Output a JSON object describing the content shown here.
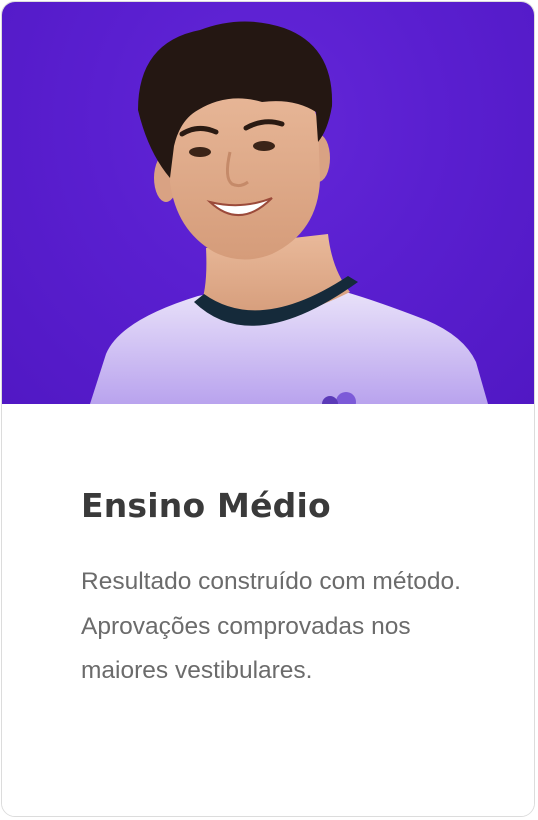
{
  "card": {
    "title": "Ensino Médio",
    "description": "Resultado construído com método. Aprovações comprovadas nos maiores vestibulares.",
    "image_alt": "Smiling student wearing a light lavender t-shirt",
    "colors": {
      "hero_background": "#5a1fd0",
      "title": "#3a3a3a",
      "description": "#6b6b6b"
    }
  }
}
